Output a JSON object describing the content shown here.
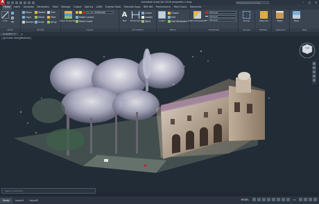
{
  "app": {
    "logo": "A",
    "window_title": "Autodesk AutoCAD 2018    prospetto 1.dwg",
    "search_placeholder": "Type a keyword or phrase"
  },
  "window_controls": {
    "minimize": "–",
    "maximize": "□",
    "close": "✕"
  },
  "ribbon_tabs": [
    "Home",
    "Insert",
    "Annotate",
    "Parametric",
    "View",
    "Manage",
    "Output",
    "Add-ins",
    "A360",
    "Express Tools",
    "Featured Apps",
    "BIM 360",
    "Performance",
    "Point Cloud",
    "Mavericks"
  ],
  "ribbon_active_tab_index": 0,
  "ribbon": {
    "draw": {
      "title": "Draw",
      "line": "Line",
      "polyline": "Polyline",
      "circle": "Circle",
      "arc": "Arc"
    },
    "modify": {
      "title": "Modify",
      "items": [
        "Move",
        "Rotate",
        "Trim",
        "Copy",
        "Mirror",
        "Fillet",
        "Stretch",
        "Scale",
        "Array"
      ]
    },
    "layers": {
      "title": "Layers",
      "layer_properties": "Layer Properties",
      "current_layer": "0 - CC_UTENSARIE",
      "items": [
        "Make Current",
        "Match Layer"
      ]
    },
    "annotation": {
      "title": "Annotation",
      "text": "Text",
      "dimension": "Dimension",
      "items": [
        "Linear",
        "Leader",
        "Table"
      ]
    },
    "block": {
      "title": "Block",
      "insert": "Insert",
      "items": [
        "Create",
        "Edit",
        "Edit Attributes"
      ]
    },
    "properties": {
      "title": "Properties",
      "match_properties": "Match Properties",
      "combo_color": "ByLayer",
      "combo_linetype": "ByLayer",
      "combo_lineweight": "ByLayer"
    },
    "groups": {
      "title": "Groups",
      "group": "Group"
    },
    "utilities": {
      "title": "Utilities",
      "measure": "Measure"
    },
    "clipboard": {
      "title": "Clipboard",
      "paste": "Paste"
    },
    "view": {
      "title": "View",
      "base": "Base"
    }
  },
  "file_tabs": [
    "prospetto 1*"
  ],
  "file_tab_add": "+",
  "viewport": {
    "label": "[-][Custom View][Realistic]",
    "cube_face": "TOP"
  },
  "command_line": {
    "placeholder": "Type a command"
  },
  "status": {
    "layout_tabs": [
      "Model",
      "Layout1",
      "Layout2"
    ],
    "active_layout_index": 0,
    "model_label": "MODEL",
    "scale": "1:1"
  },
  "colors": {
    "background": "#222c36",
    "ribbon": "#3b4552",
    "logo": "#c0262d"
  }
}
